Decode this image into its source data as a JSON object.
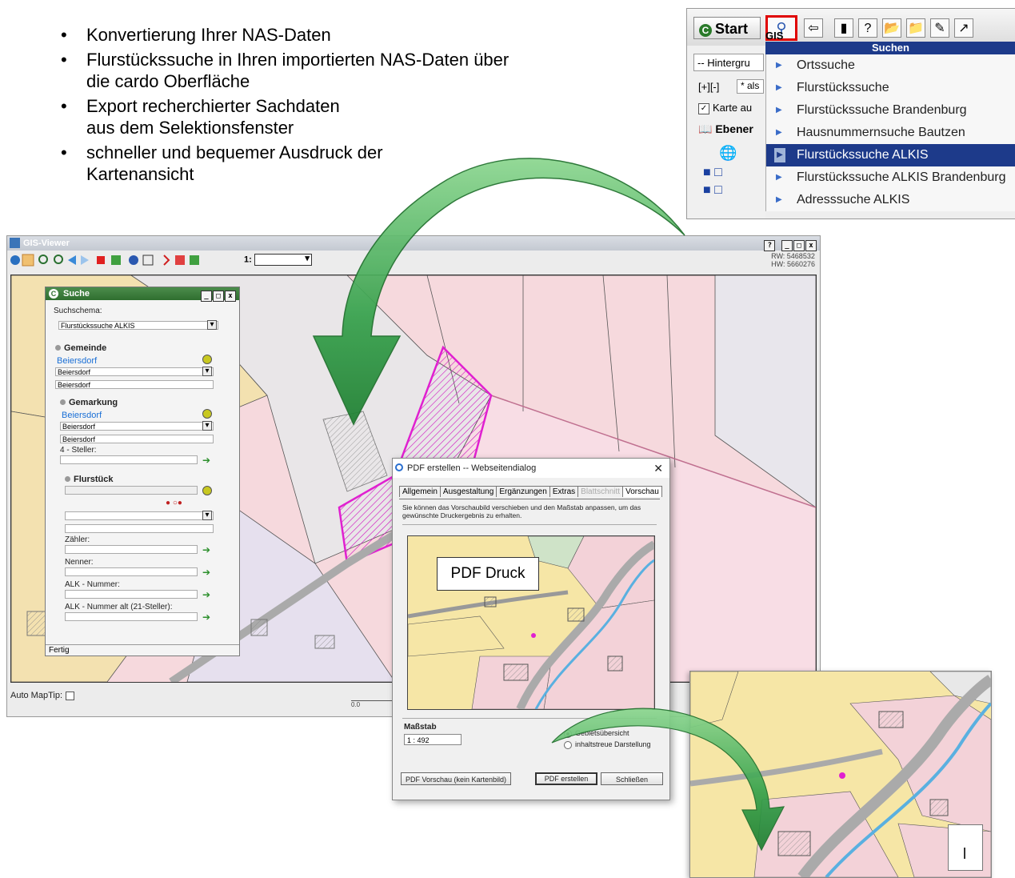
{
  "bullets": [
    {
      "lines": [
        "Konvertierung Ihrer NAS-Daten"
      ]
    },
    {
      "lines": [
        "Flurstückssuche in Ihren importierten NAS-Daten über",
        "die cardo Oberfläche"
      ]
    },
    {
      "lines": [
        "Export recherchierter Sachdaten",
        "aus dem Selektionsfenster"
      ]
    },
    {
      "lines": [
        "schneller und bequemer Ausdruck der",
        "Kartenansicht"
      ]
    }
  ],
  "topmenu": {
    "start_label": "Start",
    "menu_title": "Suchen",
    "left_fragments": [
      "GIS",
      "-- Hintergru",
      "* als",
      "Karte au",
      "Ebener"
    ],
    "items": [
      {
        "label": "Ortssuche",
        "selected": false
      },
      {
        "label": "Flurstückssuche",
        "selected": false
      },
      {
        "label": "Flurstückssuche Brandenburg",
        "selected": false
      },
      {
        "label": "Hausnummernsuche Bautzen",
        "selected": false
      },
      {
        "label": "Flurstückssuche ALKIS",
        "selected": true
      },
      {
        "label": "Flurstückssuche ALKIS Brandenburg",
        "selected": false
      },
      {
        "label": "Adresssuche ALKIS",
        "selected": false
      }
    ]
  },
  "gis": {
    "title": "GIS-Viewer",
    "scale_prefix": "1:",
    "rw": "RW: 5468532",
    "hw": "HW: 5660276",
    "auto_maptip": "Auto MapTip:",
    "scale_zero": "0.0"
  },
  "suche": {
    "title": "Suche",
    "schema_label": "Suchschema:",
    "schema_value": "Flurstückssuche ALKIS",
    "gemeinde_header": "Gemeinde",
    "gemeinde_link": "Beiersdorf",
    "gemeinde_select": "Beiersdorf",
    "gemeinde_text": "Beiersdorf",
    "gemarkung_header": "Gemarkung",
    "gemarkung_link": "Beiersdorf",
    "gemarkung_select": "Beiersdorf",
    "gemarkung_text": "Beiersdorf",
    "steller_label": "4 - Steller:",
    "flurstueck_header": "Flurstück",
    "zaehler_label": "Zähler:",
    "nenner_label": "Nenner:",
    "alk_label": "ALK - Nummer:",
    "alk_alt_label": "ALK - Nummer alt (21-Steller):",
    "status": "Fertig"
  },
  "pdf": {
    "title": "PDF erstellen -- Webseitendialog",
    "tabs": [
      {
        "label": "Allgemein",
        "state": "normal"
      },
      {
        "label": "Ausgestaltung",
        "state": "normal"
      },
      {
        "label": "Ergänzungen",
        "state": "normal"
      },
      {
        "label": "Extras",
        "state": "normal"
      },
      {
        "label": "Blattschnitt",
        "state": "disabled"
      },
      {
        "label": "Vorschau",
        "state": "active"
      }
    ],
    "description": "Sie können das Vorschaubild verschieben und den Maßstab anpassen, um das gewünschte Druckergebnis zu erhalten.",
    "preview_label": "PDF Druck",
    "massstab_label": "Maßstab",
    "massstab_value": "1 : 492",
    "radio_1": "Gebietsübersicht",
    "radio_2": "inhaltstreue Darstellung",
    "btn_preview": "PDF Vorschau (kein Kartenbild)",
    "btn_create": "PDF erstellen",
    "btn_close": "Schließen"
  },
  "colors": {
    "arrow_green": "#2f8f3f",
    "parcel_pink": "#f6d9dd",
    "parcel_yellow": "#f3e1b0",
    "highlight_magenta": "#e020d0",
    "menu_blue": "#1d3a8a"
  }
}
